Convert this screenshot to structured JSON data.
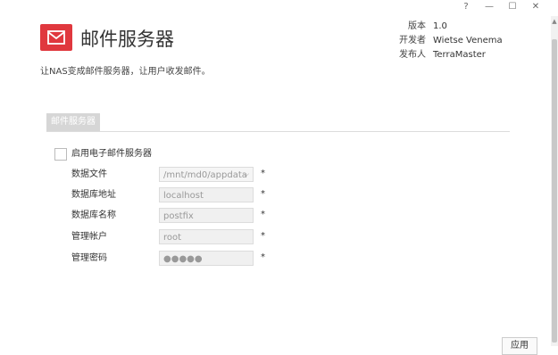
{
  "window": {
    "help_glyph": "?",
    "minimize_glyph": "—",
    "maximize_glyph": "☐",
    "close_glyph": "✕"
  },
  "app": {
    "title": "邮件服务器",
    "description": "让NAS变成邮件服务器，让用户收发邮件。",
    "icon": "mail-envelope-icon",
    "accent": "#e0383e"
  },
  "meta": {
    "version_label": "版本",
    "version": "1.0",
    "developer_label": "开发者",
    "developer": "Wietse Venema",
    "publisher_label": "发布人",
    "publisher": "TerraMaster"
  },
  "tabs": [
    {
      "label": "邮件服务器"
    }
  ],
  "form": {
    "enable_label": "启用电子邮件服务器",
    "data_file": {
      "label": "数据文件",
      "value": "/mnt/md0/appdata"
    },
    "db_address": {
      "label": "数据库地址",
      "value": "localhost"
    },
    "db_name": {
      "label": "数据库名称",
      "value": "postfix"
    },
    "admin_account": {
      "label": "管理帐户",
      "value": "root"
    },
    "admin_password": {
      "label": "管理密码",
      "value": "●●●●●"
    },
    "required_mark": "*"
  },
  "buttons": {
    "apply": "应用"
  }
}
